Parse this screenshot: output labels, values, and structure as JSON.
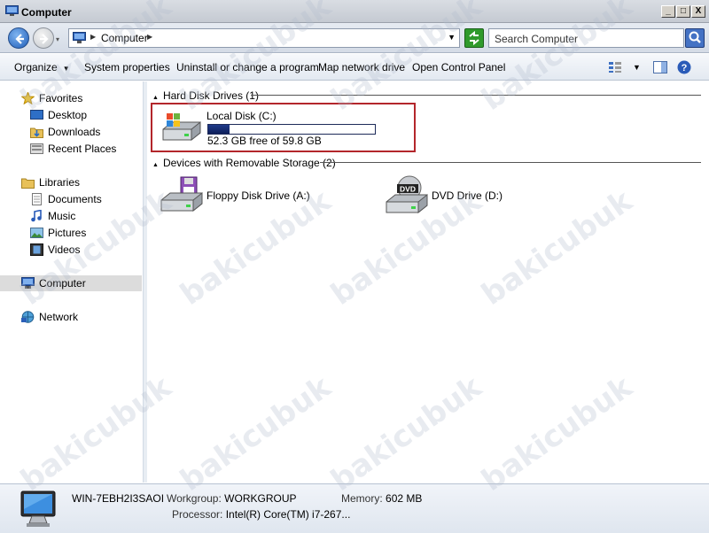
{
  "window": {
    "title": "Computer",
    "min": "_",
    "max": "□",
    "close": "X"
  },
  "address": {
    "location": "Computer",
    "search_placeholder": "Search Computer"
  },
  "toolbar": {
    "organize": "Organize",
    "system_properties": "System properties",
    "uninstall": "Uninstall or change a program",
    "map_drive": "Map network drive",
    "control_panel": "Open Control Panel"
  },
  "nav": {
    "favorites": "Favorites",
    "desktop": "Desktop",
    "downloads": "Downloads",
    "recent": "Recent Places",
    "libraries": "Libraries",
    "documents": "Documents",
    "music": "Music",
    "pictures": "Pictures",
    "videos": "Videos",
    "computer": "Computer",
    "network": "Network"
  },
  "groups": {
    "hdd": "Hard Disk Drives (1)",
    "removable": "Devices with Removable Storage (2)"
  },
  "drives": {
    "local": {
      "name": "Local Disk (C:)",
      "free_text": "52.3 GB free of 59.8 GB",
      "used_fraction": 0.125
    },
    "floppy": {
      "name": "Floppy Disk Drive (A:)"
    },
    "dvd": {
      "name": "DVD Drive (D:)",
      "badge": "DVD"
    }
  },
  "details": {
    "name": "WIN-7EBH2I3SAOI",
    "workgroup_label": "Workgroup:",
    "workgroup": "WORKGROUP",
    "memory_label": "Memory:",
    "memory": "602 MB",
    "processor_label": "Processor:",
    "processor": "Intel(R) Core(TM) i7-267..."
  },
  "watermark": "bakicubuk",
  "colors": {
    "accent": "#1f3a8a",
    "highlight_border": "#b3262b"
  }
}
